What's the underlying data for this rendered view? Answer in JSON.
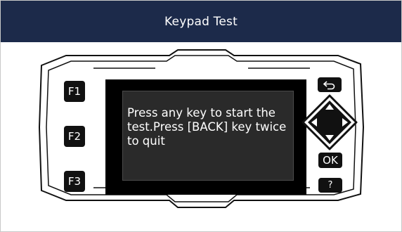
{
  "window": {
    "title": "Keypad Test"
  },
  "screen": {
    "message": "Press any key to start the test.Press [BACK] key twice to quit"
  },
  "keys": {
    "f1": "F1",
    "f2": "F2",
    "f3": "F3",
    "ok": "OK",
    "help": "?"
  },
  "icons": {
    "back": "back-arrow-icon",
    "dpad": "dpad-icon"
  },
  "colors": {
    "titlebar": "#1c2a4a",
    "key": "#111111",
    "screen_inner": "#2a2a2a"
  }
}
